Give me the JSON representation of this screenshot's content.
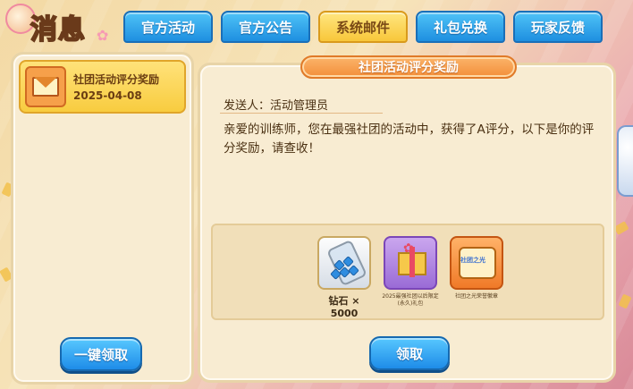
{
  "header": {
    "title": "消息",
    "tabs": [
      {
        "label": "官方活动",
        "active": false
      },
      {
        "label": "官方公告",
        "active": false
      },
      {
        "label": "系统邮件",
        "active": true
      },
      {
        "label": "礼包兑换",
        "active": false
      },
      {
        "label": "玩家反馈",
        "active": false
      }
    ]
  },
  "mail_list": {
    "items": [
      {
        "title": "社团活动评分奖励",
        "date": "2025-04-08",
        "icon": "envelope-icon",
        "selected": true
      }
    ],
    "claim_all_label": "一键领取"
  },
  "mail_detail": {
    "title": "社团活动评分奖励",
    "sender": "发送人：活动管理员",
    "body": "亲爱的训练师，您在最强社团的活动中，获得了A评分，以下是你的评分奖励，请查收！",
    "rewards": [
      {
        "name": "钻石 × 5000",
        "icon": "diamond-jar-icon"
      },
      {
        "name": "2025最强社团以后限定(永久)礼包",
        "icon": "gift-pack-icon"
      },
      {
        "name": "社团之光荣誉徽章",
        "icon": "club-badge-icon"
      }
    ],
    "claim_label": "领取"
  },
  "colors": {
    "tab_blue": "#1e8fe0",
    "tab_active": "#f8c73a",
    "panel": "#f8ecd2",
    "title_bar": "#f38f3a"
  }
}
